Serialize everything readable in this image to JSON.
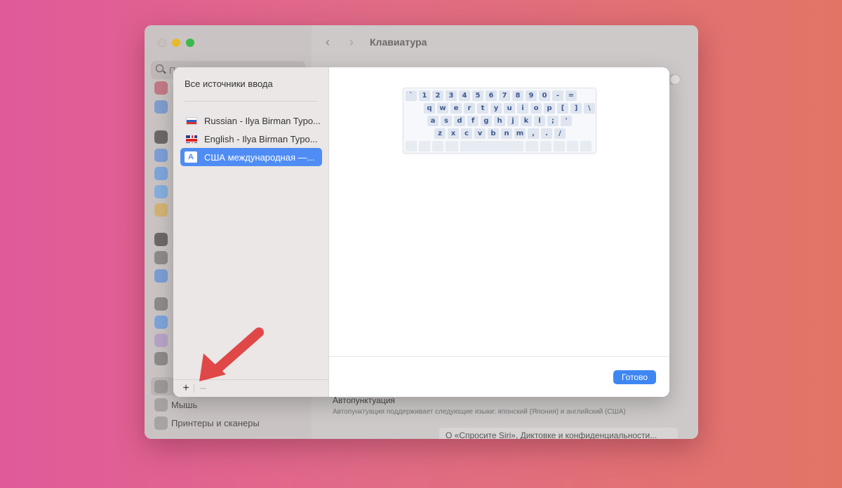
{
  "window": {
    "title": "Клавиатура",
    "search_placeholder": "П"
  },
  "sidebar": {
    "items": [
      {
        "label": "Мышь",
        "icon": "mouse-icon"
      },
      {
        "label": "Принтеры и сканеры",
        "icon": "printer-icon"
      }
    ]
  },
  "main": {
    "autopunct_title": "Автопунктуация",
    "autopunct_desc": "Автопунктуация поддерживает следующие языки: японский (Япония) и английский (США)",
    "siri_button": "О «Спросите Siri», Диктовке и конфиденциальности..."
  },
  "sheet": {
    "heading": "Все источники ввода",
    "sources": [
      {
        "label": "Russian - Ilya Birman Typo...",
        "flag": "ru-flag-icon",
        "selected": false
      },
      {
        "label": "English - Ilya Birman Typo...",
        "flag": "gb-flag-icon",
        "selected": false
      },
      {
        "label": "США международная —...",
        "flag": "letter-a-icon",
        "icon_letter": "A",
        "selected": true
      }
    ],
    "add_label": "+",
    "remove_label": "–",
    "done_label": "Готово",
    "keyboard": {
      "row1": [
        "`",
        "1",
        "2",
        "3",
        "4",
        "5",
        "6",
        "7",
        "8",
        "9",
        "0",
        "-",
        "="
      ],
      "row2": [
        "q",
        "w",
        "e",
        "r",
        "t",
        "y",
        "u",
        "i",
        "o",
        "p",
        "[",
        "]",
        "\\"
      ],
      "row3": [
        "a",
        "s",
        "d",
        "f",
        "g",
        "h",
        "j",
        "k",
        "l",
        ";",
        "'"
      ],
      "row4": [
        "z",
        "x",
        "c",
        "v",
        "b",
        "n",
        "m",
        ",",
        ".",
        "/"
      ]
    }
  },
  "colors": {
    "accent": "#4f8df4",
    "done_button": "#3f86f3",
    "arrow": "#e04848"
  }
}
